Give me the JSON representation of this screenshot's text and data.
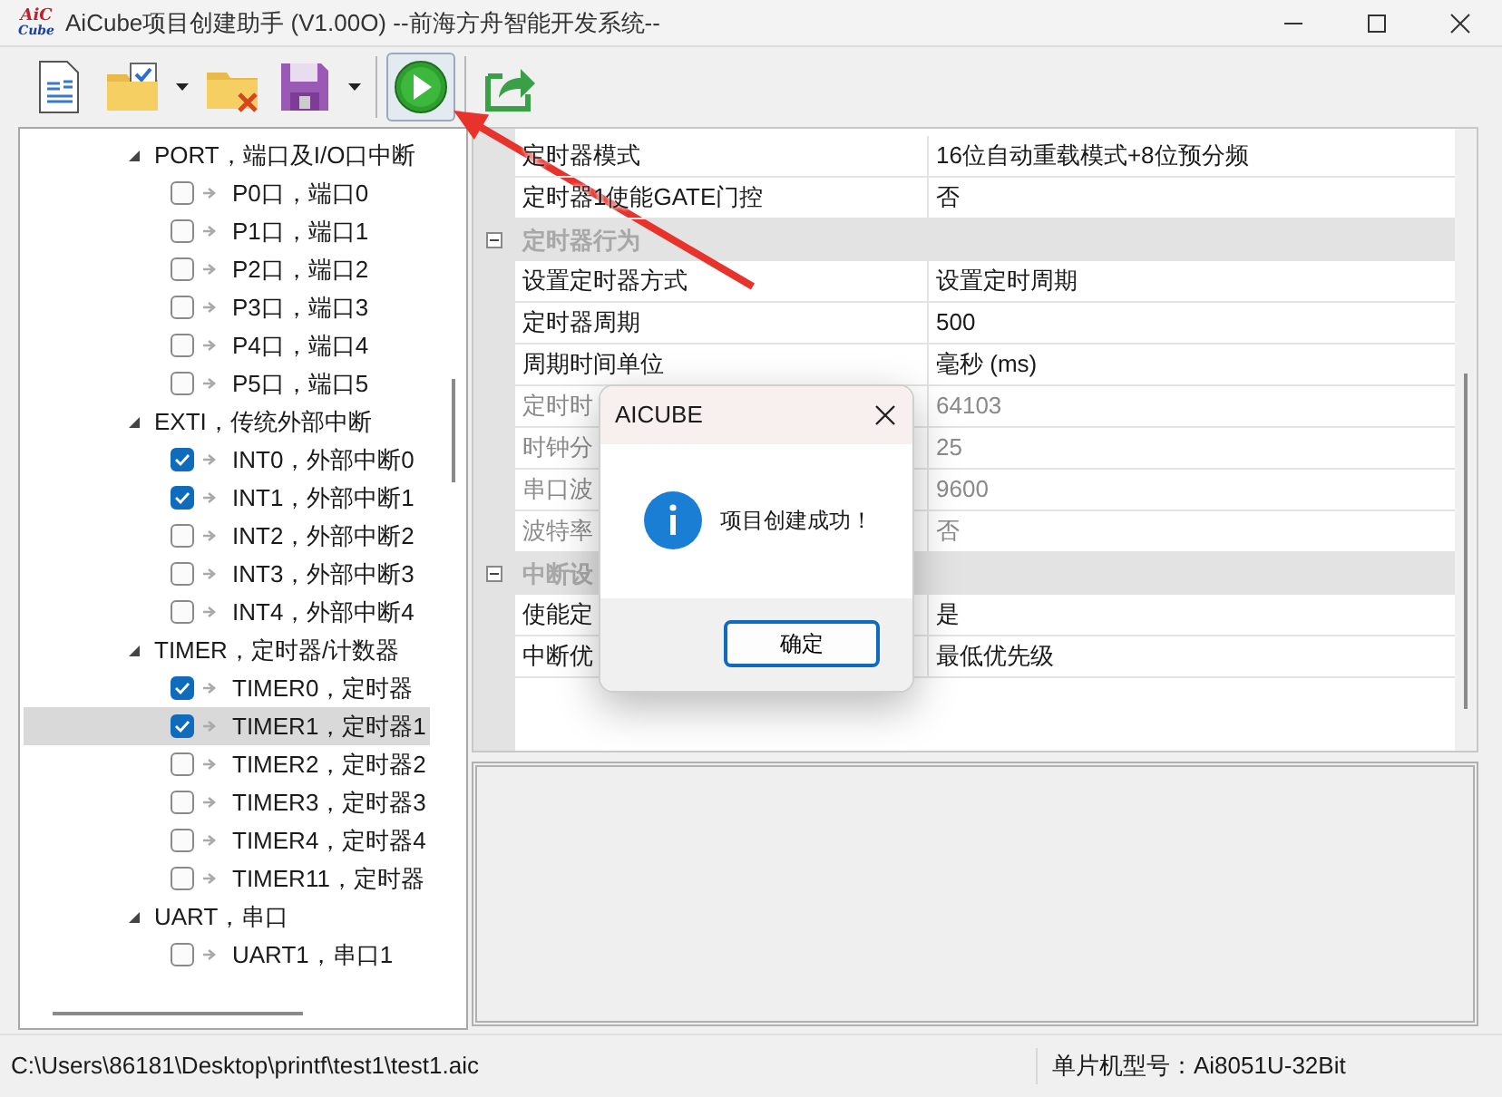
{
  "window": {
    "title": "AiCube项目创建助手 (V1.00O) --前海方舟智能开发系统--",
    "logo": [
      "AiC",
      "Cube"
    ]
  },
  "toolbar": [
    {
      "kind": "document",
      "dropdown": false,
      "highlighted": false
    },
    {
      "kind": "folder-check",
      "dropdown": true,
      "highlighted": false
    },
    {
      "kind": "folder-x",
      "dropdown": false,
      "highlighted": false
    },
    {
      "kind": "floppy",
      "dropdown": true,
      "highlighted": false
    },
    {
      "kind": "separator"
    },
    {
      "kind": "play",
      "dropdown": false,
      "highlighted": true
    },
    {
      "kind": "separator"
    },
    {
      "kind": "share",
      "dropdown": false,
      "highlighted": false
    }
  ],
  "tree": [
    {
      "label": "PORT，端口及I/O口中断",
      "expanded": true,
      "children": [
        {
          "label": "P0口，端口0",
          "checked": false,
          "selected": false
        },
        {
          "label": "P1口，端口1",
          "checked": false,
          "selected": false
        },
        {
          "label": "P2口，端口2",
          "checked": false,
          "selected": false
        },
        {
          "label": "P3口，端口3",
          "checked": false,
          "selected": false
        },
        {
          "label": "P4口，端口4",
          "checked": false,
          "selected": false
        },
        {
          "label": "P5口，端口5",
          "checked": false,
          "selected": false
        }
      ]
    },
    {
      "label": "EXTI，传统外部中断",
      "expanded": true,
      "children": [
        {
          "label": "INT0，外部中断0",
          "checked": true,
          "selected": false
        },
        {
          "label": "INT1，外部中断1",
          "checked": true,
          "selected": false
        },
        {
          "label": "INT2，外部中断2",
          "checked": false,
          "selected": false
        },
        {
          "label": "INT3，外部中断3",
          "checked": false,
          "selected": false
        },
        {
          "label": "INT4，外部中断4",
          "checked": false,
          "selected": false
        }
      ]
    },
    {
      "label": "TIMER，定时器/计数器",
      "expanded": true,
      "children": [
        {
          "label": "TIMER0，定时器",
          "checked": true,
          "selected": false
        },
        {
          "label": "TIMER1，定时器1",
          "checked": true,
          "selected": true
        },
        {
          "label": "TIMER2，定时器2",
          "checked": false,
          "selected": false
        },
        {
          "label": "TIMER3，定时器3",
          "checked": false,
          "selected": false
        },
        {
          "label": "TIMER4，定时器4",
          "checked": false,
          "selected": false
        },
        {
          "label": "TIMER11，定时器",
          "checked": false,
          "selected": false
        }
      ]
    },
    {
      "label": "UART，串口",
      "expanded": true,
      "children": [
        {
          "label": "UART1，串口1",
          "checked": false,
          "selected": false
        }
      ]
    }
  ],
  "properties": [
    {
      "kind": "row",
      "name": "定时器模式",
      "value": "16位自动重载模式+8位预分频",
      "disabled": false
    },
    {
      "kind": "row",
      "name": "定时器1使能GATE门控",
      "value": "否",
      "disabled": false
    },
    {
      "kind": "category",
      "name": "定时器行为",
      "expanded": true
    },
    {
      "kind": "row",
      "name": "设置定时器方式",
      "value": "设置定时周期",
      "disabled": false
    },
    {
      "kind": "row",
      "name": "定时器周期",
      "value": "500",
      "disabled": false
    },
    {
      "kind": "row",
      "name": "周期时间单位",
      "value": "毫秒 (ms)",
      "disabled": false
    },
    {
      "kind": "row",
      "name": "定时时",
      "value": "64103",
      "disabled": true
    },
    {
      "kind": "row",
      "name": "时钟分",
      "value": "25",
      "disabled": true
    },
    {
      "kind": "row",
      "name": "串口波",
      "value": "9600",
      "disabled": true
    },
    {
      "kind": "row",
      "name": "波特率",
      "value": "否",
      "disabled": true
    },
    {
      "kind": "category",
      "name": "中断设",
      "expanded": true
    },
    {
      "kind": "row",
      "name": "使能定",
      "value": "是",
      "disabled": false
    },
    {
      "kind": "row",
      "name": "中断优",
      "value": "最低优先级",
      "disabled": false
    }
  ],
  "dialog": {
    "title": "AICUBE",
    "message": "项目创建成功！",
    "button": "确定"
  },
  "status_bar": {
    "path": "C:\\Users\\86181\\Desktop\\printf\\test1\\test1.aic",
    "model": "单片机型号：Ai8051U-32Bit"
  }
}
